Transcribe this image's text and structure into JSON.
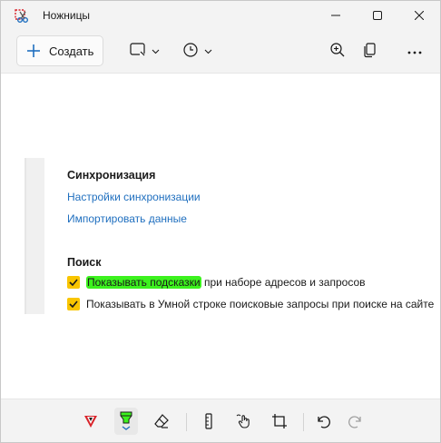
{
  "window": {
    "title": "Ножницы"
  },
  "toolbar": {
    "create_label": "Создать",
    "icons": [
      "snip-mode-icon",
      "timer-icon",
      "zoom-icon",
      "copy-icon",
      "more-icon"
    ]
  },
  "content": {
    "sync": {
      "title": "Синхронизация",
      "links": [
        "Настройки синхронизации",
        "Импортировать данные"
      ]
    },
    "search": {
      "title": "Поиск",
      "option1_highlighted": "Показывать подсказки",
      "option1_rest": " при наборе адресов и запросов",
      "option2": "Показывать в Умной строке поисковые запросы при поиске на сайте"
    }
  },
  "bottom_toolbar": {
    "tools": [
      "pen-icon",
      "highlighter-icon",
      "eraser-icon",
      "ruler-icon",
      "touch-writing-icon",
      "crop-icon",
      "undo-icon",
      "redo-icon"
    ]
  },
  "colors": {
    "highlight": "#3cf21e",
    "checkbox": "#f9c500",
    "link": "#1f6fbf",
    "pen": "#d8232a"
  }
}
